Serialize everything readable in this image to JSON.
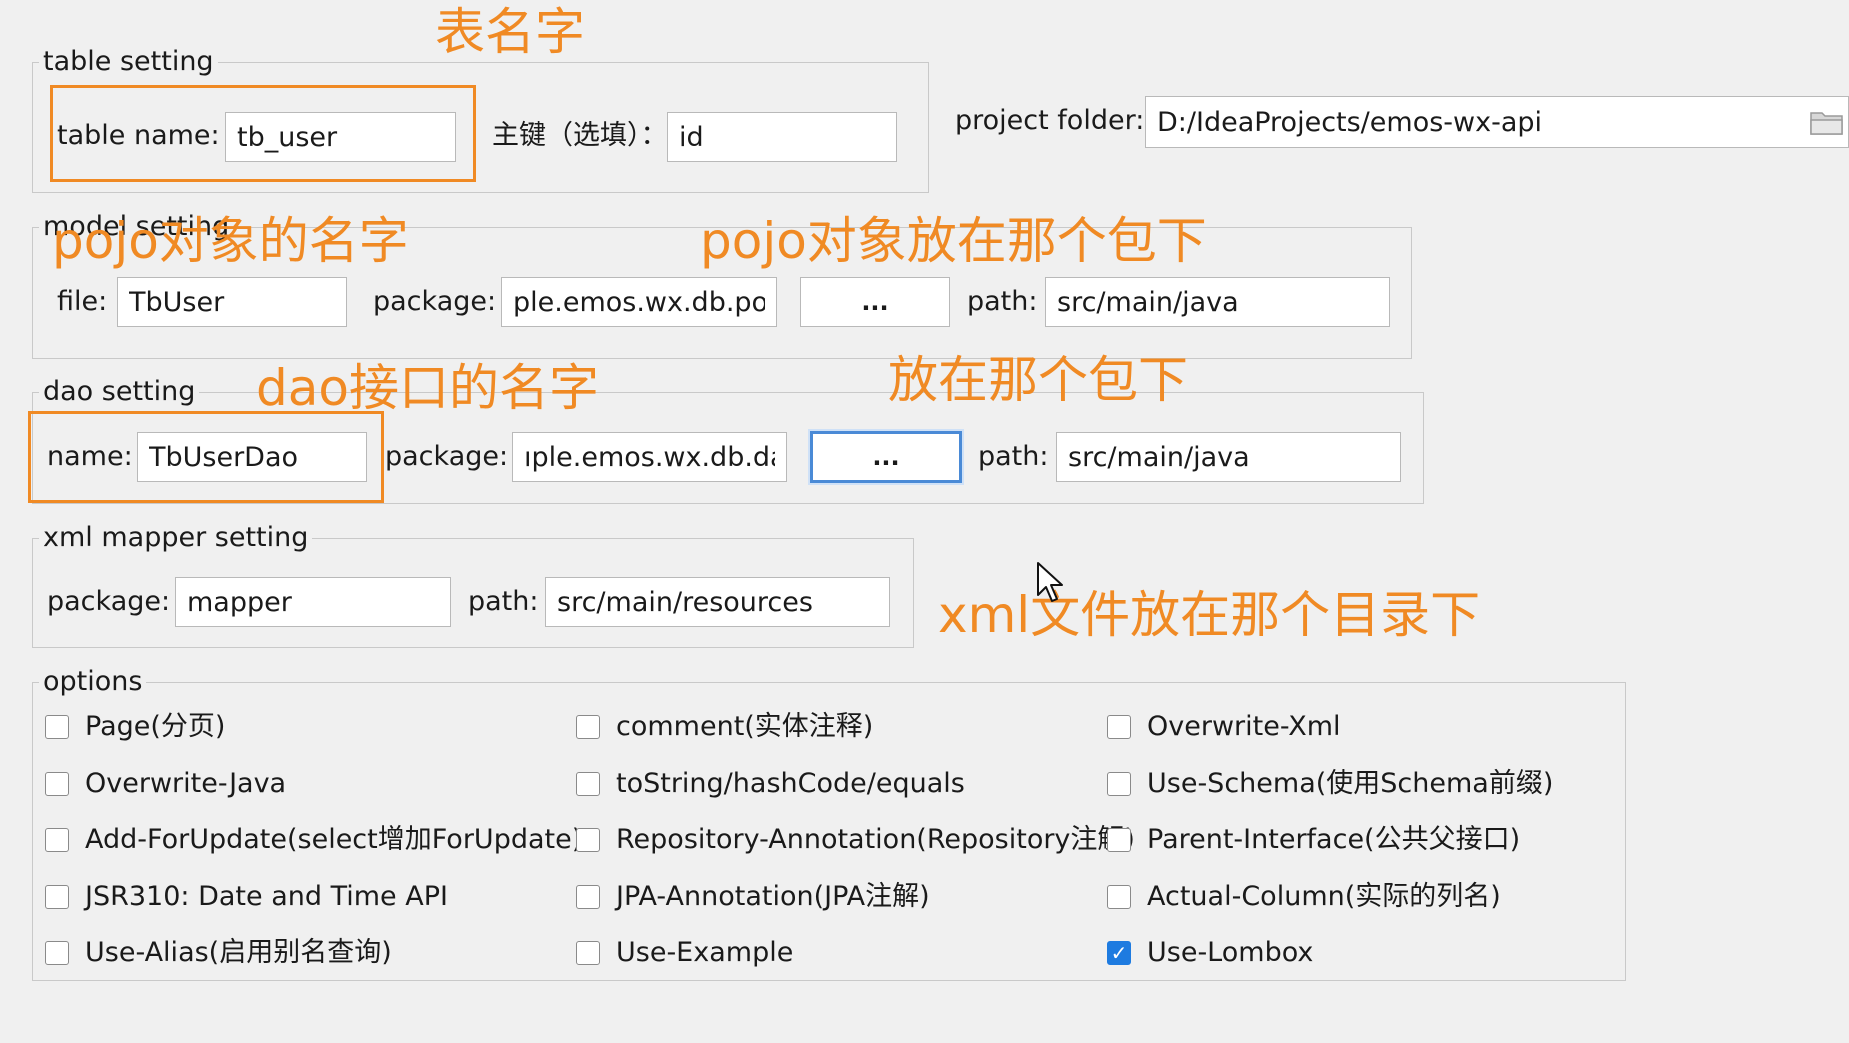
{
  "table_setting": {
    "legend": "table setting",
    "table_name_label": "table  name:",
    "table_name_value": "tb_user",
    "pk_label": "主键（选填）：",
    "pk_value": "id"
  },
  "project": {
    "folder_label": "project folder:",
    "folder_value": "D:/IdeaProjects/emos-wx-api",
    "browse_icon": "folder-icon"
  },
  "model_setting": {
    "legend": "model setting",
    "file_label": "file:",
    "file_value": "TbUser",
    "package_label": "package:",
    "package_value": "ple.emos.wx.db.pojo",
    "browse_label": "...",
    "path_label": "path:",
    "path_value": "src/main/java"
  },
  "dao_setting": {
    "legend": "dao setting",
    "name_label": "name:",
    "name_value": "TbUserDao",
    "package_label": "package:",
    "package_value": "ıple.emos.wx.db.dao",
    "browse_label": "...",
    "path_label": "path:",
    "path_value": "src/main/java"
  },
  "xml_setting": {
    "legend": "xml mapper setting",
    "package_label": "package:",
    "package_value": "mapper",
    "path_label": "path:",
    "path_value": "src/main/resources"
  },
  "options": {
    "legend": "options",
    "items": [
      {
        "label": "Page(分页)",
        "checked": false
      },
      {
        "label": "comment(实体注释)",
        "checked": false
      },
      {
        "label": "Overwrite-Xml",
        "checked": false
      },
      {
        "label": "Overwrite-Java",
        "checked": false
      },
      {
        "label": "toString/hashCode/equals",
        "checked": false
      },
      {
        "label": "Use-Schema(使用Schema前缀)",
        "checked": false
      },
      {
        "label": "Add-ForUpdate(select增加ForUpdate)",
        "checked": false
      },
      {
        "label": "Repository-Annotation(Repository注解)",
        "checked": false
      },
      {
        "label": "Parent-Interface(公共父接口)",
        "checked": false
      },
      {
        "label": "JSR310: Date and Time API",
        "checked": false
      },
      {
        "label": "JPA-Annotation(JPA注解)",
        "checked": false
      },
      {
        "label": "Actual-Column(实际的列名)",
        "checked": false
      },
      {
        "label": "Use-Alias(启用别名查询)",
        "checked": false
      },
      {
        "label": "Use-Example",
        "checked": false
      },
      {
        "label": "Use-Lombox",
        "checked": true
      }
    ]
  },
  "annotations": {
    "color": "#f08a24",
    "table_name_note": "表名字",
    "pojo_name_note": "pojo对象的名字",
    "pojo_package_note": "pojo对象放在那个包下",
    "dao_name_note": "dao接口的名字",
    "dao_package_note": "放在那个包下",
    "xml_dir_note": "xml文件放在那个目录下"
  },
  "colors": {
    "background": "#f0f0f0",
    "checkbox_checked": "#1e7be0",
    "focus_ring": "#4a8ad6"
  }
}
